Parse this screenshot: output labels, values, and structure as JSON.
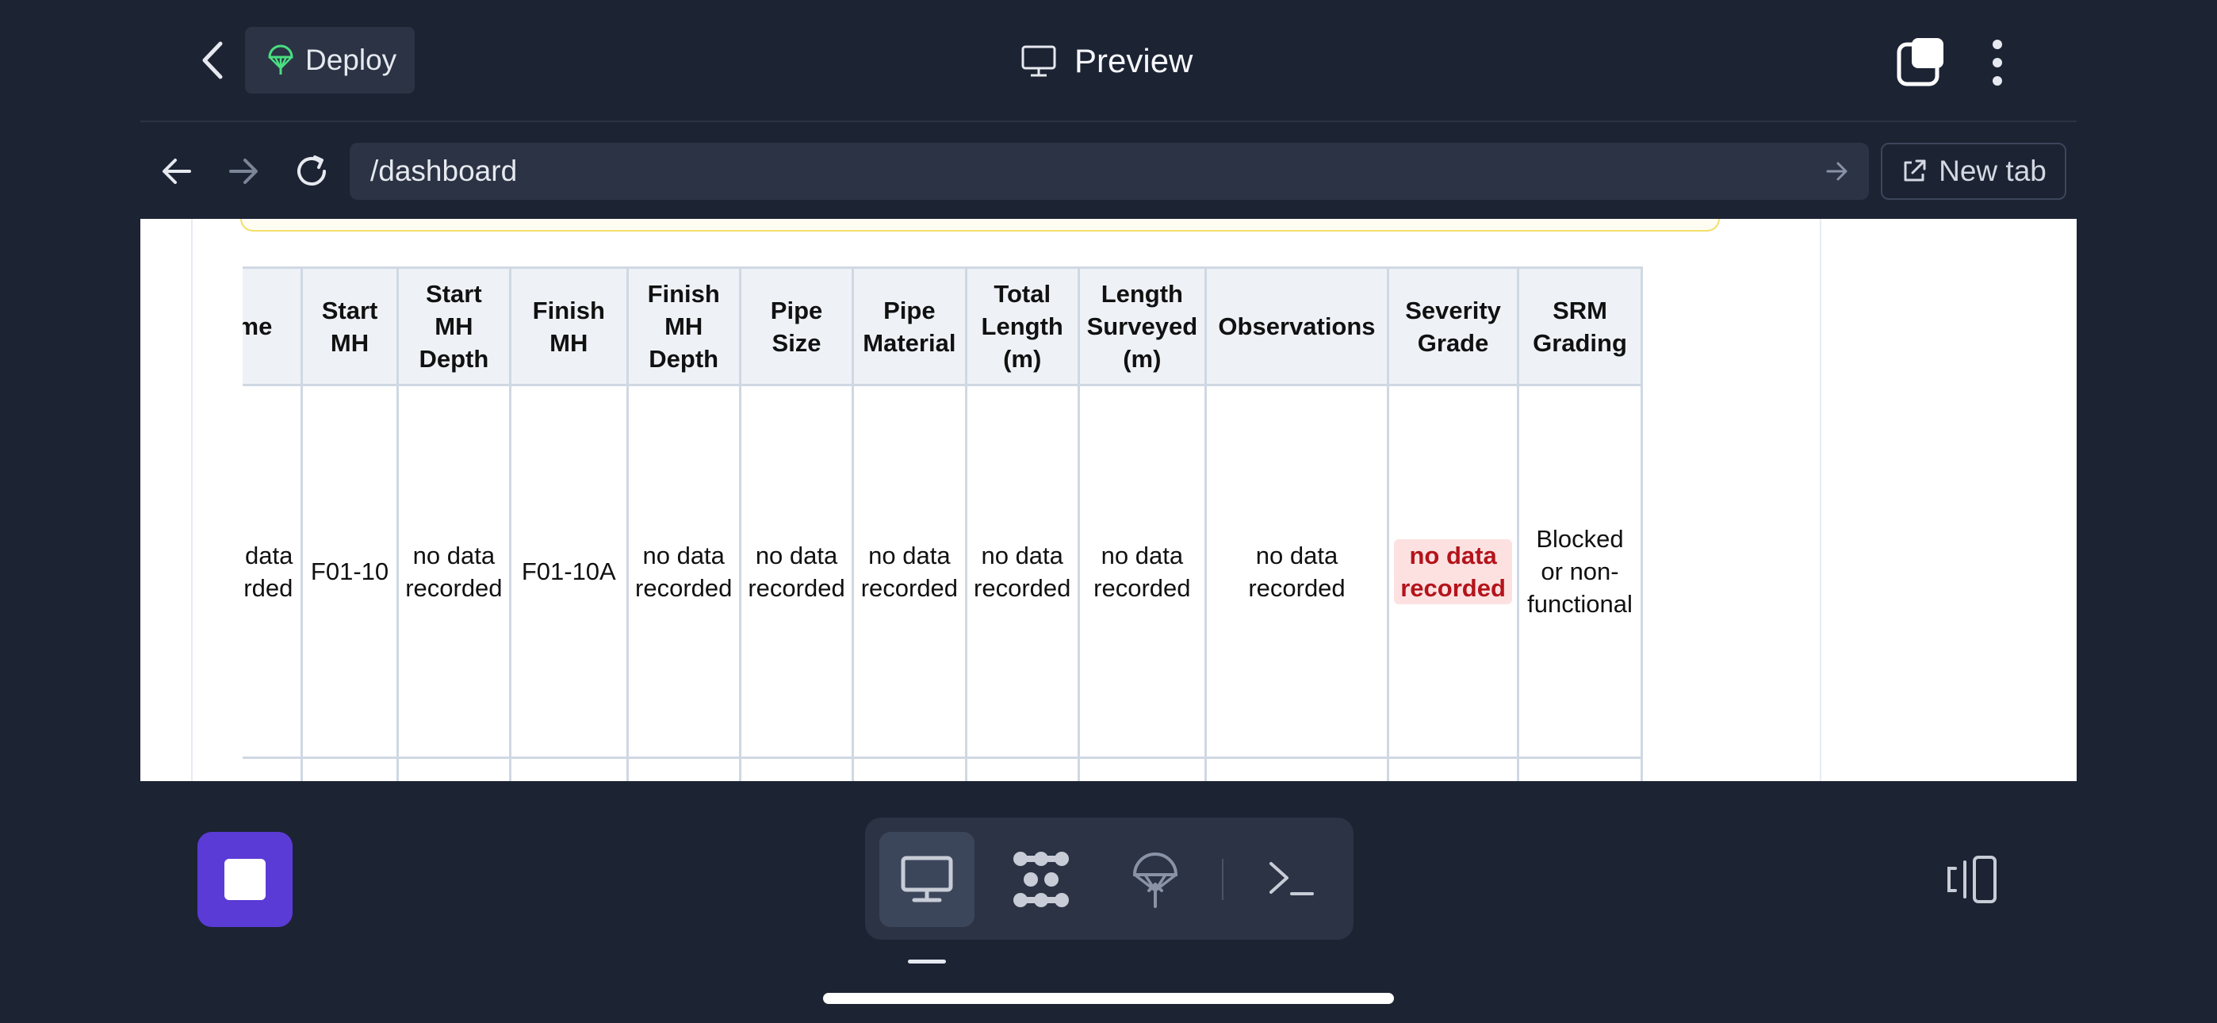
{
  "header": {
    "deploy_label": "Deploy",
    "title": "Preview"
  },
  "browser": {
    "url": "/dashboard",
    "new_tab_label": "New tab"
  },
  "table": {
    "columns": [
      "Time",
      "Start MH",
      "Start MH Depth",
      "Finish MH",
      "Finish MH Depth",
      "Pipe Size",
      "Pipe Material",
      "Total Length (m)",
      "Length Surveyed (m)",
      "Observations",
      "Severity Grade",
      "SRM Grading"
    ],
    "rows": [
      [
        "no data recorded",
        "F01-10",
        "no data recorded",
        "F01-10A",
        "no data recorded",
        "no data recorded",
        "no data recorded",
        "no data recorded",
        "no data recorded",
        "no data recorded",
        "no data recorded",
        "Blocked or non-functional"
      ]
    ]
  },
  "colors": {
    "background": "#1c2333",
    "surface": "#2b3345",
    "accent": "#5b3bd6",
    "deploy_icon": "#4ade80",
    "severity_text": "#b3141b",
    "severity_bg": "#fde1e1"
  },
  "icons": {
    "back": "chevron-left-icon",
    "deploy": "parachute-icon",
    "preview": "monitor-icon",
    "tabs": "tabs-icon",
    "more": "kebab-icon",
    "nav_back": "arrow-left-icon",
    "nav_forward": "arrow-right-icon",
    "reload": "reload-icon",
    "go": "arrow-right-icon",
    "new_tab": "external-link-icon",
    "stop": "stop-icon",
    "dock": [
      "monitor-icon",
      "packages-icon",
      "deploy-icon",
      "terminal-icon"
    ],
    "layout": "split-view-icon"
  }
}
